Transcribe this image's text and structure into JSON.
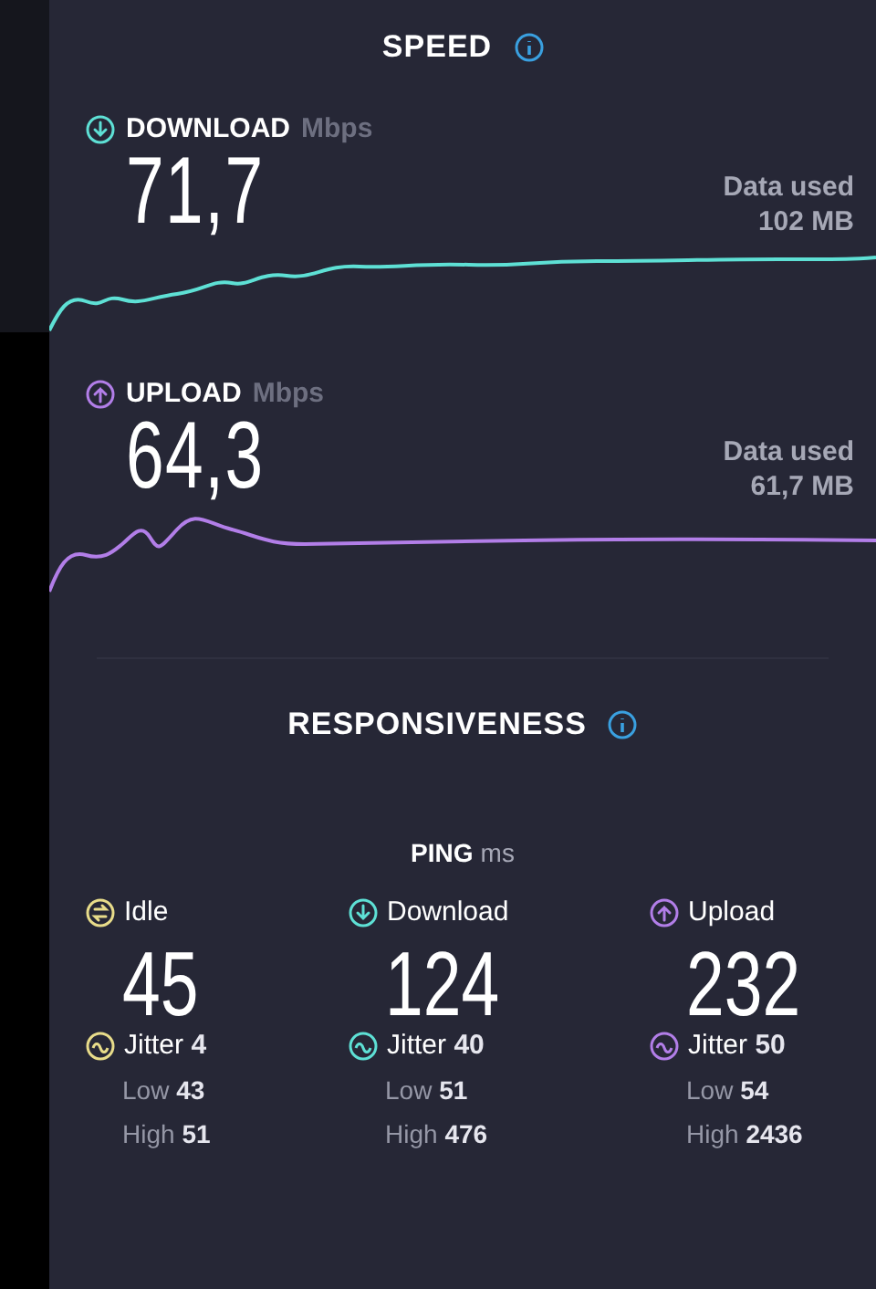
{
  "speed": {
    "title": "SPEED",
    "tests": [
      {
        "kind": "download",
        "label": "DOWNLOAD",
        "unit": "Mbps",
        "value": "71,7",
        "data_label": "Data used",
        "data_value": "102 MB",
        "color": "#5ee0d5"
      },
      {
        "kind": "upload",
        "label": "UPLOAD",
        "unit": "Mbps",
        "value": "64,3",
        "data_label": "Data used",
        "data_value": "61,7 MB",
        "color": "#b27ee8"
      }
    ]
  },
  "responsiveness": {
    "title": "RESPONSIVENESS",
    "ping_label": "PING",
    "ping_unit": "ms",
    "columns": [
      {
        "kind": "idle",
        "label": "Idle",
        "value": "45",
        "color": "#e8dc8a",
        "jitter": "Jitter **4**",
        "low": "Low **43**",
        "high": "High **51**"
      },
      {
        "kind": "download",
        "label": "Download",
        "value": "124",
        "color": "#5ee0d5",
        "jitter": "Jitter **40**",
        "low": "Low **51**",
        "high": "High **476**"
      },
      {
        "kind": "upload",
        "label": "Upload",
        "value": "232",
        "color": "#b27ee8",
        "jitter": "Jitter **50**",
        "low": "Low **54**",
        "high": "High **2436**"
      }
    ]
  }
}
